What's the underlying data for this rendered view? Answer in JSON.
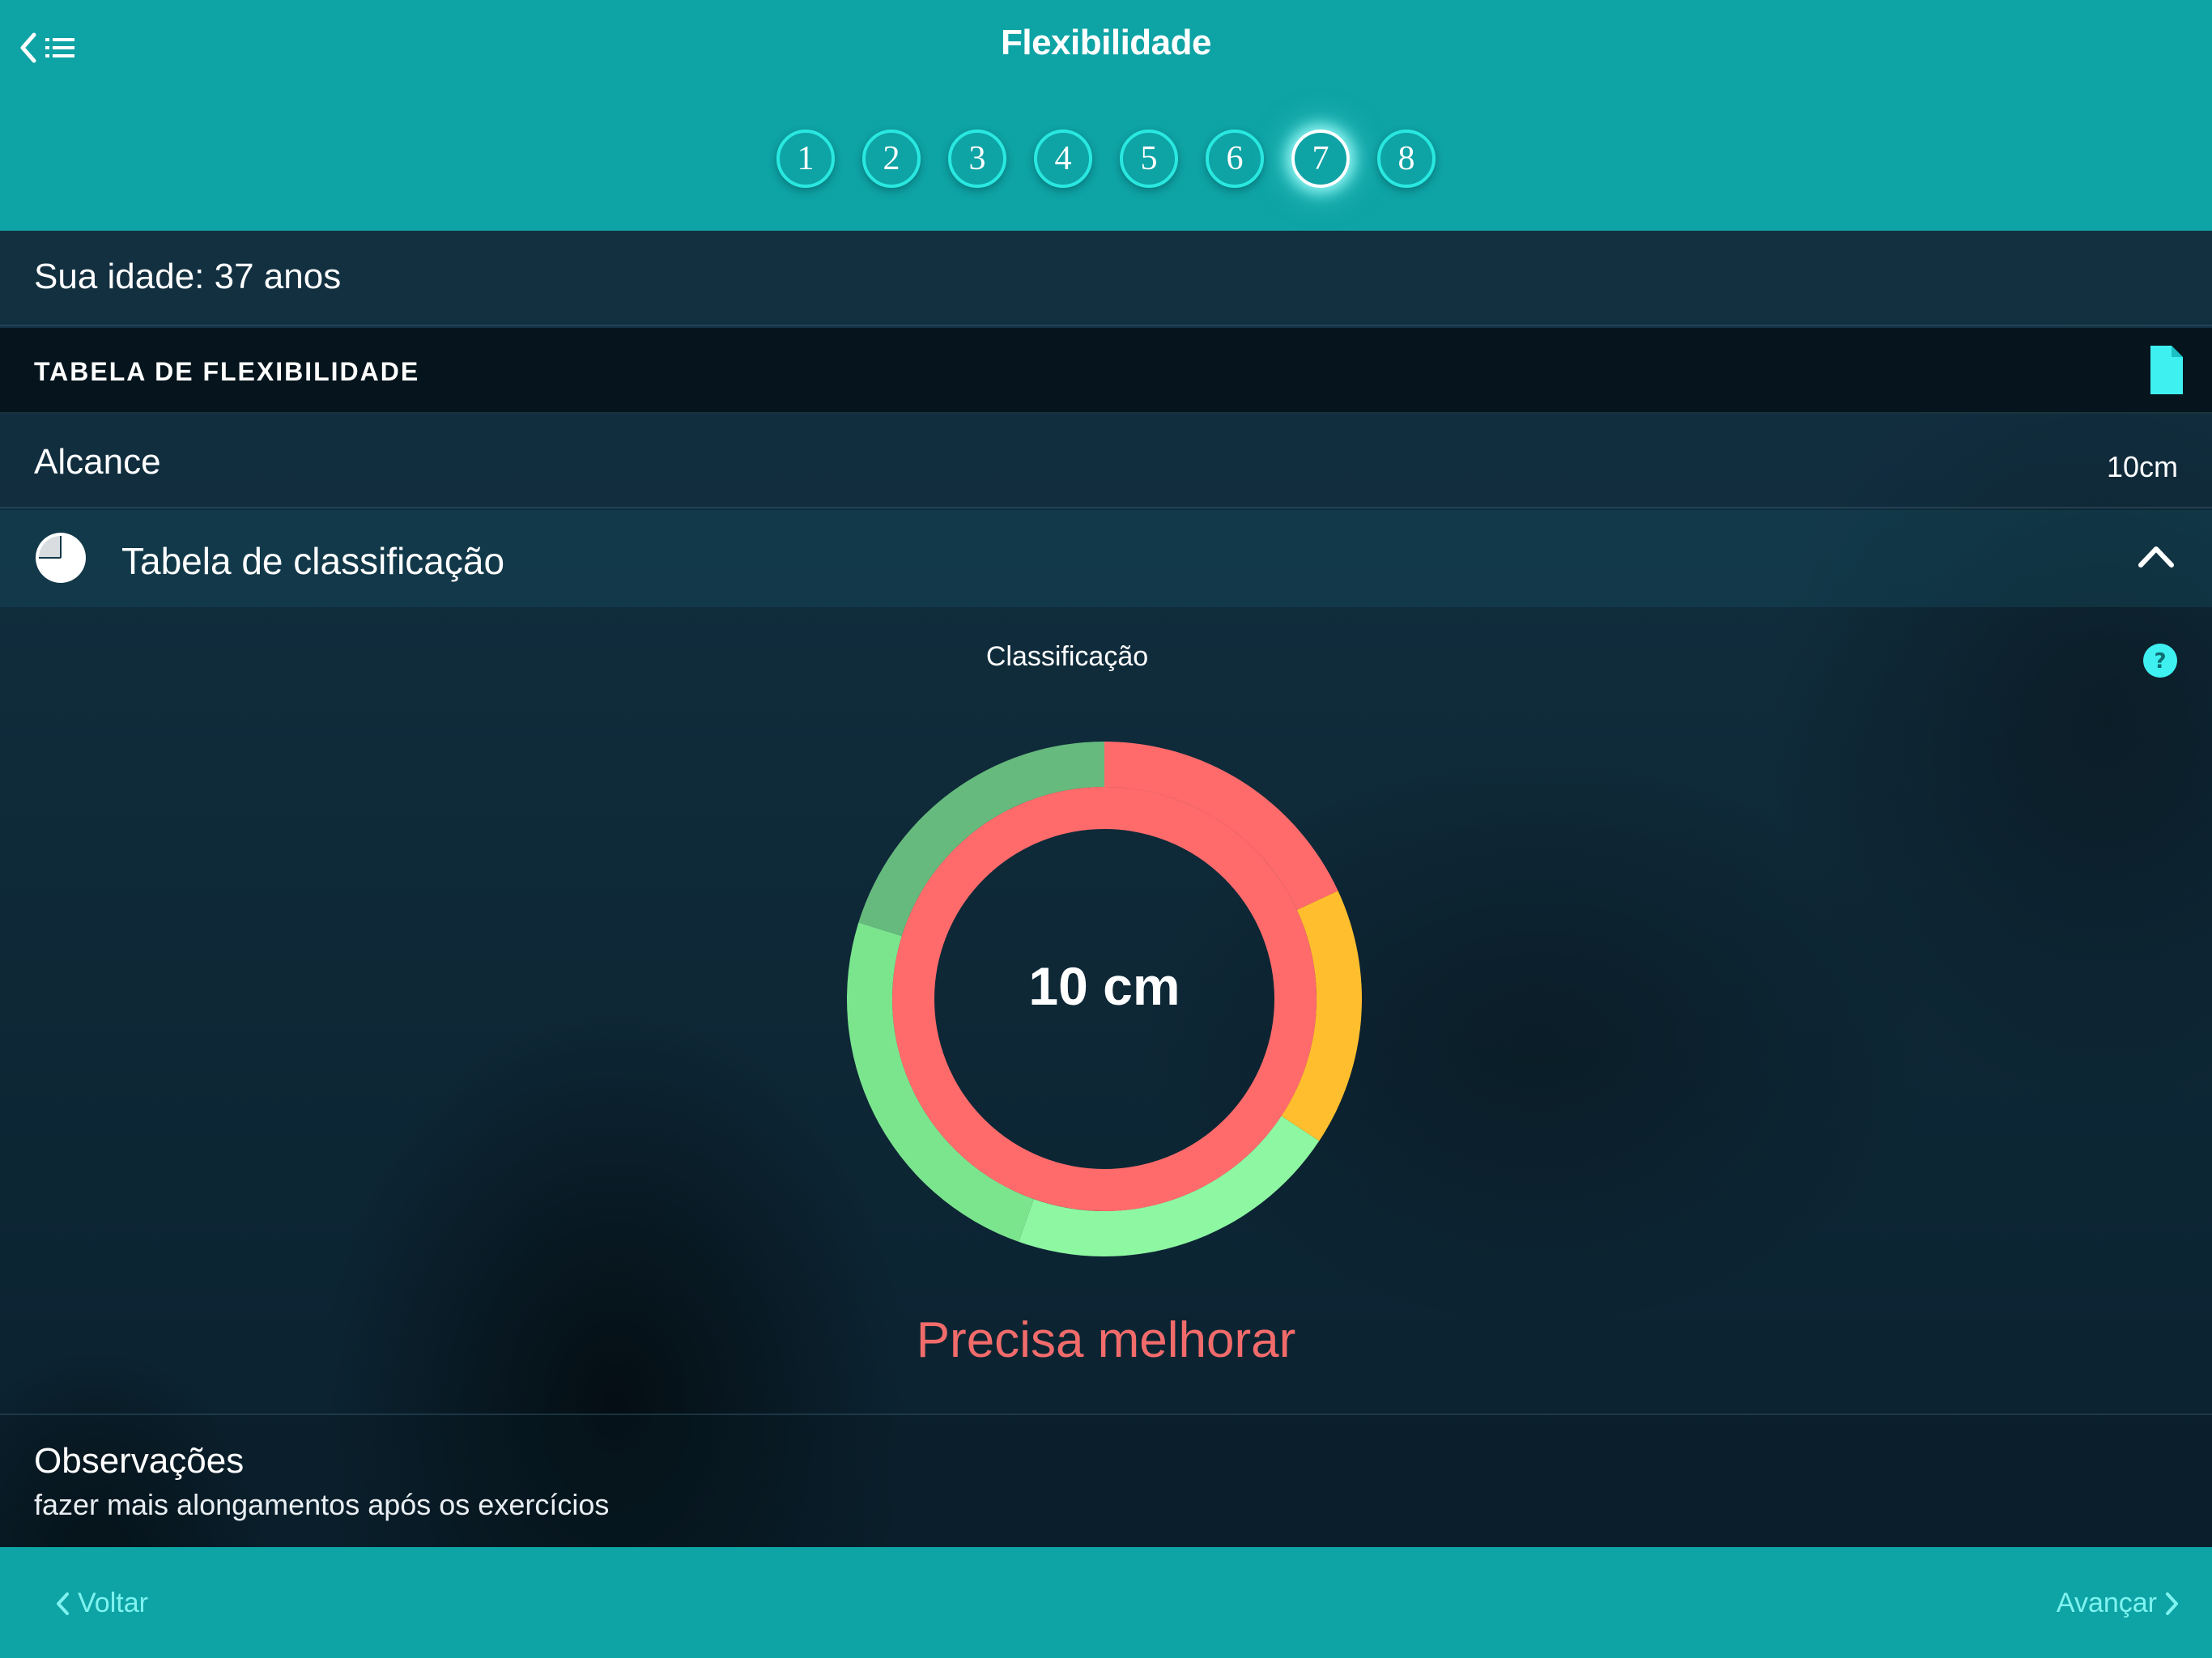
{
  "header": {
    "title": "Flexibilidade",
    "steps": [
      "1",
      "2",
      "3",
      "4",
      "5",
      "6",
      "7",
      "8"
    ],
    "active_step": 7
  },
  "age": {
    "text": "Sua idade: 37 anos"
  },
  "table_section": {
    "title": "TABELA DE FLEXIBILIDADE"
  },
  "reach": {
    "label": "Alcance",
    "value": "10cm"
  },
  "classification": {
    "header": "Tabela de classificação",
    "chart_title": "Classificação",
    "center_value": "10 cm",
    "status": "Precisa melhorar"
  },
  "chart_data": {
    "type": "pie",
    "outer_ring": [
      {
        "color": "#ff6b6b",
        "fraction": 0.181
      },
      {
        "color": "#ffbe2e",
        "fraction": 0.162
      },
      {
        "color": "#8ef7a2",
        "fraction": 0.211
      },
      {
        "color": "#7be58e",
        "fraction": 0.244
      },
      {
        "color": "#66ba7d",
        "fraction": 0.202
      }
    ],
    "inner_ring": [
      {
        "color": "#ff6b6b",
        "fraction": 1.0
      }
    ]
  },
  "observations": {
    "title": "Observações",
    "text": "fazer mais alongamentos após os exercícios"
  },
  "footer": {
    "prev_label": "Voltar",
    "next_label": "Avançar"
  },
  "colors": {
    "accent": "#0ea3a5",
    "step_border": "#29e8e0",
    "status": "#f26b6b"
  }
}
